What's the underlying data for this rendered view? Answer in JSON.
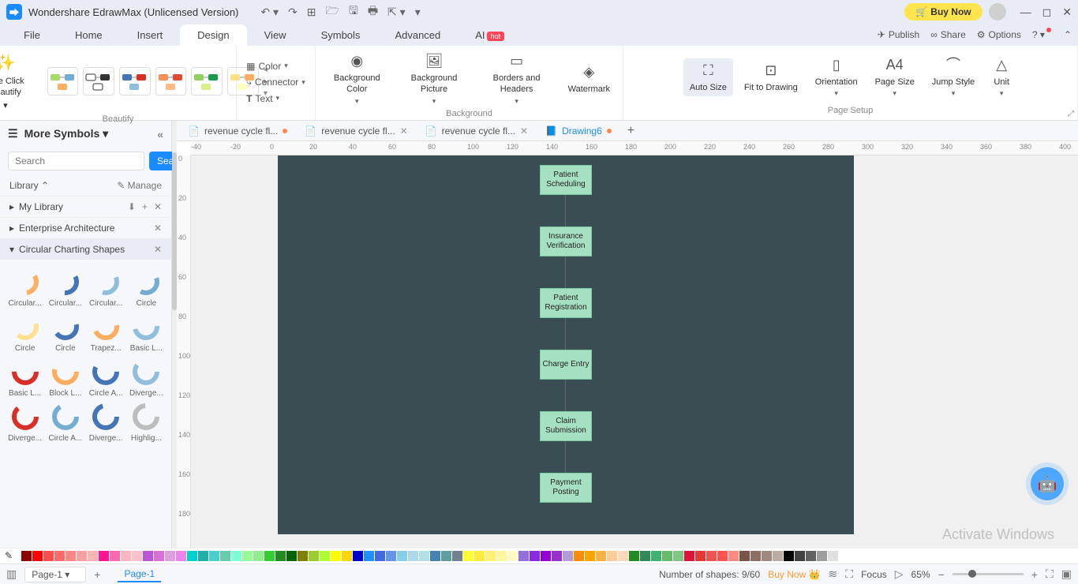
{
  "title": "Wondershare EdrawMax (Unlicensed Version)",
  "buyNow": "Buy Now",
  "menu": {
    "file": "File",
    "home": "Home",
    "insert": "Insert",
    "design": "Design",
    "view": "View",
    "symbols": "Symbols",
    "advanced": "Advanced",
    "ai": "AI",
    "aiBadge": "hot",
    "publish": "Publish",
    "share": "Share",
    "options": "Options"
  },
  "ribbon": {
    "oneClick": "One Click Beautify",
    "beautifyLabel": "Beautify",
    "color": "Color",
    "connector": "Connector",
    "text": "Text",
    "bgColor": "Background Color",
    "bgPic": "Background Picture",
    "borders": "Borders and Headers",
    "watermark": "Watermark",
    "bgLabel": "Background",
    "autoSize": "Auto Size",
    "fit": "Fit to Drawing",
    "orientation": "Orientation",
    "pageSize": "Page Size",
    "jump": "Jump Style",
    "unit": "Unit",
    "pageSetup": "Page Setup"
  },
  "sidebar": {
    "more": "More Symbols",
    "searchPlaceholder": "Search",
    "searchBtn": "Search",
    "library": "Library",
    "manage": "Manage",
    "myLibrary": "My Library",
    "enterprise": "Enterprise Architecture",
    "circular": "Circular Charting Shapes",
    "shapes": [
      "Circular...",
      "Circular...",
      "Circular...",
      "Circle",
      "Circle",
      "Circle",
      "Trapez...",
      "Basic L...",
      "Basic L...",
      "Block L...",
      "Circle A...",
      "Diverge...",
      "Diverge...",
      "Circle A...",
      "Diverge...",
      "Highlig..."
    ]
  },
  "tabs": {
    "t1": "revenue cycle fl...",
    "t2": "revenue cycle fl...",
    "t3": "revenue cycle fl...",
    "t4": "Drawing6"
  },
  "rulerH": [
    "-40",
    "-20",
    "0",
    "20",
    "40",
    "60",
    "80",
    "100",
    "120",
    "140",
    "160",
    "180",
    "200",
    "220",
    "240",
    "260",
    "280",
    "300",
    "320",
    "340",
    "360",
    "380",
    "400"
  ],
  "rulerV": [
    "0",
    "20",
    "40",
    "60",
    "80",
    "100",
    "120",
    "140",
    "160",
    "180"
  ],
  "flow": [
    "Patient Scheduling",
    "Insurance Verification",
    "Patient Registration",
    "Charge Entry",
    "Claim Submission",
    "Payment Posting"
  ],
  "activate": "Activate Windows",
  "colors": [
    "#8b0000",
    "#ff0000",
    "#ff4d4d",
    "#ff6b6b",
    "#ff8787",
    "#ffa0a0",
    "#ffb3b3",
    "#ff1493",
    "#ff69b4",
    "#ffb6c1",
    "#ffc0cb",
    "#ba55d3",
    "#da70d6",
    "#dda0dd",
    "#ee82ee",
    "#00ced1",
    "#20b2aa",
    "#48d1cc",
    "#66cdaa",
    "#7fffd4",
    "#98fb98",
    "#90ee90",
    "#32cd32",
    "#228b22",
    "#006400",
    "#808000",
    "#9acd32",
    "#adff2f",
    "#ffff00",
    "#ffd700",
    "#0000cd",
    "#1e90ff",
    "#4169e1",
    "#6495ed",
    "#87ceeb",
    "#add8e6",
    "#b0e0e6",
    "#4682b4",
    "#5f9ea0",
    "#708090",
    "#ffff33",
    "#ffeb3b",
    "#fff176",
    "#fff59d",
    "#fff9c4",
    "#9370db",
    "#8a2be2",
    "#9400d3",
    "#9932cc",
    "#b19cd9",
    "#ff8c00",
    "#ffa500",
    "#ffb347",
    "#ffcc99",
    "#ffdab9",
    "#228b22",
    "#2e8b57",
    "#3cb371",
    "#66bb6a",
    "#81c784",
    "#dc143c",
    "#e53935",
    "#ef5350",
    "#ff5252",
    "#ff8a80",
    "#795548",
    "#8d6e63",
    "#a1887f",
    "#bcaaa4",
    "#000000",
    "#424242",
    "#616161",
    "#9e9e9e",
    "#e0e0e0",
    "#ffffff"
  ],
  "status": {
    "page": "Page-1",
    "pageTab": "Page-1",
    "shapes": "Number of shapes: 9/60",
    "buyNow": "Buy Now",
    "focus": "Focus",
    "zoom": "65%"
  }
}
